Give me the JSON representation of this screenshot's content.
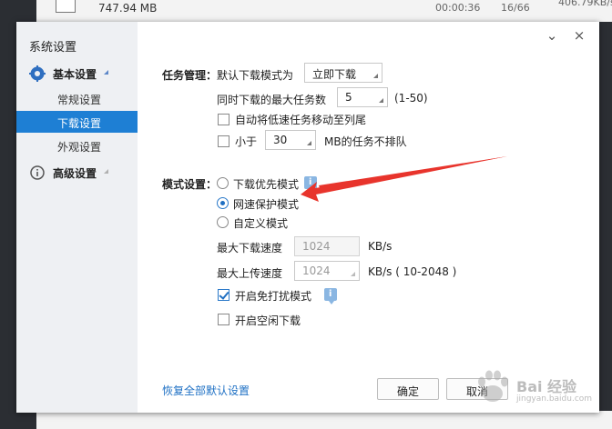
{
  "background": {
    "file_size": "747.94 MB",
    "time": "00:00:36",
    "count": "16/66",
    "speed": "406.79KB/s"
  },
  "dialog": {
    "title": "系统设置",
    "close_label": "×",
    "minimize_label": "⌄"
  },
  "sidebar": {
    "basic_group": "基本设置",
    "items": [
      {
        "label": "常规设置"
      },
      {
        "label": "下载设置",
        "active": true
      },
      {
        "label": "外观设置"
      }
    ],
    "advanced_group": "高级设置"
  },
  "task": {
    "section_label": "任务管理：",
    "default_mode_label": "默认下载模式为",
    "default_mode_value": "立即下载",
    "max_tasks_label": "同时下载的最大任务数",
    "max_tasks_value": "5",
    "max_tasks_range": "(1-50)",
    "move_slow_label": "自动将低速任务移动至列尾",
    "less_than_label": "小于",
    "less_than_value": "30",
    "less_than_suffix": "MB的任务不排队"
  },
  "mode": {
    "section_label": "模式设置：",
    "options": [
      "下载优先模式",
      "网速保护模式",
      "自定义模式"
    ],
    "selected_index": 1,
    "max_down_label": "最大下载速度",
    "max_down_value": "1024",
    "max_down_unit": "KB/s",
    "max_up_label": "最大上传速度",
    "max_up_value": "1024",
    "max_up_unit": "KB/s ( 10-2048 )",
    "no_disturb_label": "开启免打扰模式",
    "no_disturb_checked": true,
    "idle_download_label": "开启空闲下载",
    "idle_download_checked": false,
    "info_glyph": "i"
  },
  "footer": {
    "restore_link": "恢复全部默认设置",
    "ok_label": "确定",
    "cancel_label": "取消"
  },
  "watermark": {
    "text": "Bai 经验",
    "sub": "jingyan.baidu.com"
  },
  "colors": {
    "accent": "#1e7fd4",
    "annotation_arrow": "#e8342c"
  }
}
